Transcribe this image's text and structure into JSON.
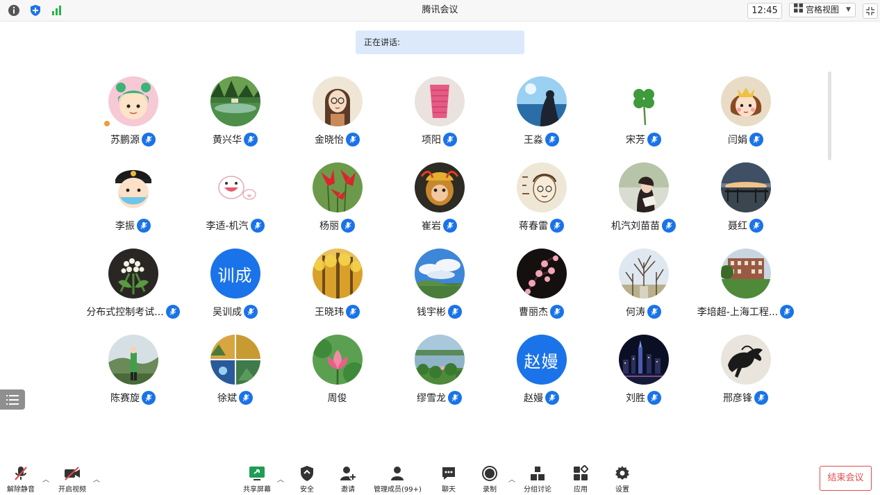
{
  "app_title": "腾讯会议",
  "clock": "12:45",
  "view_mode": "宫格视图",
  "speaking_label": "正在讲话:",
  "participants": [
    {
      "name": "苏鹏源",
      "avatar": "cartoon-girl-pink"
    },
    {
      "name": "黄兴华",
      "avatar": "lake-forest"
    },
    {
      "name": "金晓怡",
      "avatar": "cartoon-girl-glasses"
    },
    {
      "name": "项阳",
      "avatar": "pink-vase"
    },
    {
      "name": "王淼",
      "avatar": "girl-sky-sea"
    },
    {
      "name": "宋芳",
      "avatar": "clover"
    },
    {
      "name": "闫娟",
      "avatar": "cartoon-girl-crown"
    },
    {
      "name": "李振",
      "avatar": "police-cartoon"
    },
    {
      "name": "李适-机汽",
      "avatar": "crying-pig"
    },
    {
      "name": "杨丽",
      "avatar": "red-flowers"
    },
    {
      "name": "崔岩",
      "avatar": "monkey-king"
    },
    {
      "name": "蒋春雷",
      "avatar": "sketch-man"
    },
    {
      "name": "机汽刘苗苗",
      "avatar": "girl-photo"
    },
    {
      "name": "聂红",
      "avatar": "sunset-pier"
    },
    {
      "name": "分布式控制考试...",
      "avatar": "lily-bouquet"
    },
    {
      "name": "吴训成",
      "avatar": "text",
      "text": "训成"
    },
    {
      "name": "王晓玮",
      "avatar": "autumn-trees"
    },
    {
      "name": "钱宇彬",
      "avatar": "blue-sky-clouds"
    },
    {
      "name": "曹丽杰",
      "avatar": "plum-blossom"
    },
    {
      "name": "何涛",
      "avatar": "bare-trees"
    },
    {
      "name": "李培超-上海工程...",
      "avatar": "building-lawn"
    },
    {
      "name": "陈赛旋",
      "avatar": "person-hills"
    },
    {
      "name": "徐斌",
      "avatar": "photo-collage"
    },
    {
      "name": "周俊",
      "avatar": "lotus"
    },
    {
      "name": "缪雪龙",
      "avatar": "lake-lotus"
    },
    {
      "name": "赵嫚",
      "avatar": "text",
      "text": "赵嫚"
    },
    {
      "name": "刘胜",
      "avatar": "night-city"
    },
    {
      "name": "邢彦锋",
      "avatar": "horse-painting"
    }
  ],
  "toolbar": {
    "unmute": "解除静音",
    "start_video": "开启视频",
    "share_screen": "共享屏幕",
    "security": "安全",
    "invite": "邀请",
    "manage_members": "管理成员(99+)",
    "chat": "聊天",
    "record": "录制",
    "breakout": "分组讨论",
    "apps": "应用",
    "settings": "设置",
    "end_meeting": "结束会议"
  },
  "colors": {
    "accent": "#1a73e8",
    "end_red": "#e04b4b",
    "banner": "#dbe9fb"
  }
}
